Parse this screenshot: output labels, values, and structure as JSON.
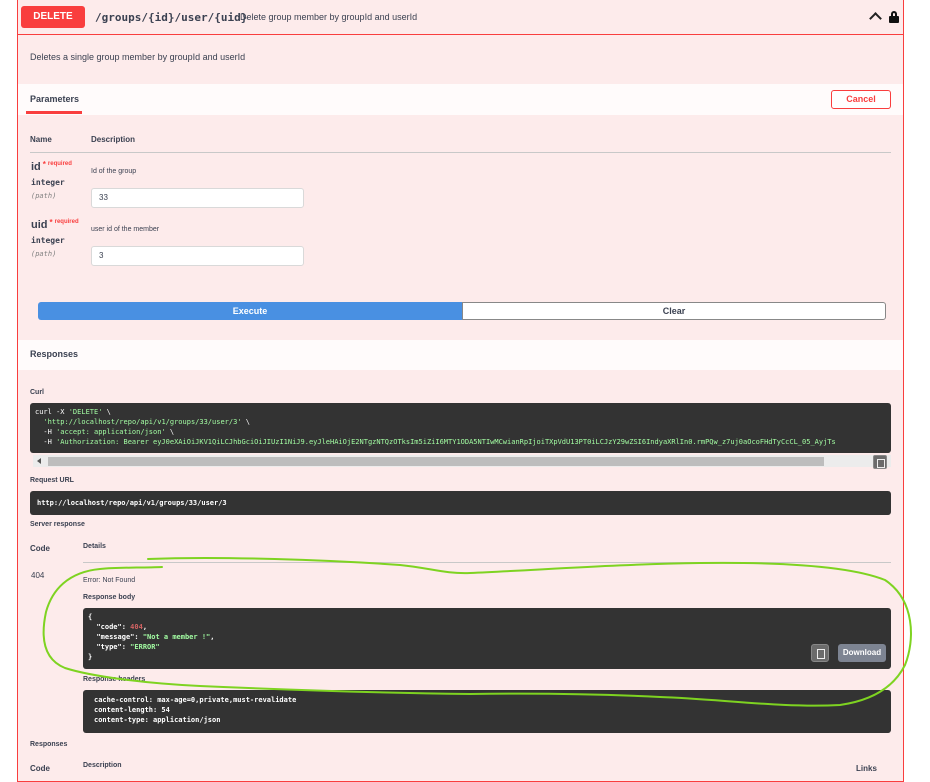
{
  "operation": {
    "method": "DELETE",
    "path": "/groups/{id}/user/{uid}",
    "summary": "Delete group member by groupId and userId",
    "description": "Deletes a single group member by groupId and userId"
  },
  "parameters_section": {
    "title": "Parameters",
    "cancel_label": "Cancel",
    "col_name": "Name",
    "col_description": "Description",
    "params": [
      {
        "name": "id",
        "star": "*",
        "required": "required",
        "type": "integer",
        "in": "(path)",
        "description": "Id of the group",
        "value": "33"
      },
      {
        "name": "uid",
        "star": "*",
        "required": "required",
        "type": "integer",
        "in": "(path)",
        "description": "user id of the member",
        "value": "3"
      }
    ]
  },
  "actions": {
    "execute_label": "Execute",
    "clear_label": "Clear"
  },
  "responses_section": {
    "title": "Responses",
    "curl_label": "Curl",
    "curl": {
      "l1a": "curl -X ",
      "l1b": "'DELETE'",
      "l1c": " \\",
      "l2a": "  ",
      "l2b": "'http://localhost/repo/api/v1/groups/33/user/3'",
      "l2c": " \\",
      "l3a": "  -H ",
      "l3b": "'accept: application/json'",
      "l3c": " \\",
      "l4a": "  -H ",
      "l4b": "'Authorization: Bearer eyJ0eXAiOiJKV1QiLCJhbGciOiJIUzI1NiJ9.eyJleHAiOjE2NTgzNTQzOTksIm5iZiI6MTY1ODA5NTIwMCwianRpIjoiTXpVdU13PT0iLCJzY29wZSI6IndyaXRlIn0.rmPQw_z7uj0aOcoFHdTyCcCL_05_AyjTs"
    },
    "request_url_label": "Request URL",
    "request_url": "http://localhost/repo/api/v1/groups/33/user/3",
    "server_response_label": "Server response",
    "col_code": "Code",
    "col_details": "Details",
    "status_code": "404",
    "status_text": "Error: Not Found",
    "response_body_label": "Response body",
    "body": {
      "open": "{",
      "k1": "\"code\"",
      "v1": "404",
      "k2": "\"message\"",
      "v2": "\"Not a member !\"",
      "k3": "\"type\"",
      "v3": "\"ERROR\"",
      "close": "}"
    },
    "download_label": "Download",
    "response_headers_label": "Response headers",
    "headers": [
      "cache-control: max-age=0,private,must-revalidate",
      "content-length: 54",
      "content-type: application/json"
    ],
    "responses_label_2": "Responses",
    "col_code_2": "Code",
    "col_description_2": "Description",
    "col_links": "Links"
  },
  "colors": {
    "delete_accent": "#f93e3e",
    "execute_blue": "#4990e2",
    "annotation_green": "#7ed321"
  }
}
